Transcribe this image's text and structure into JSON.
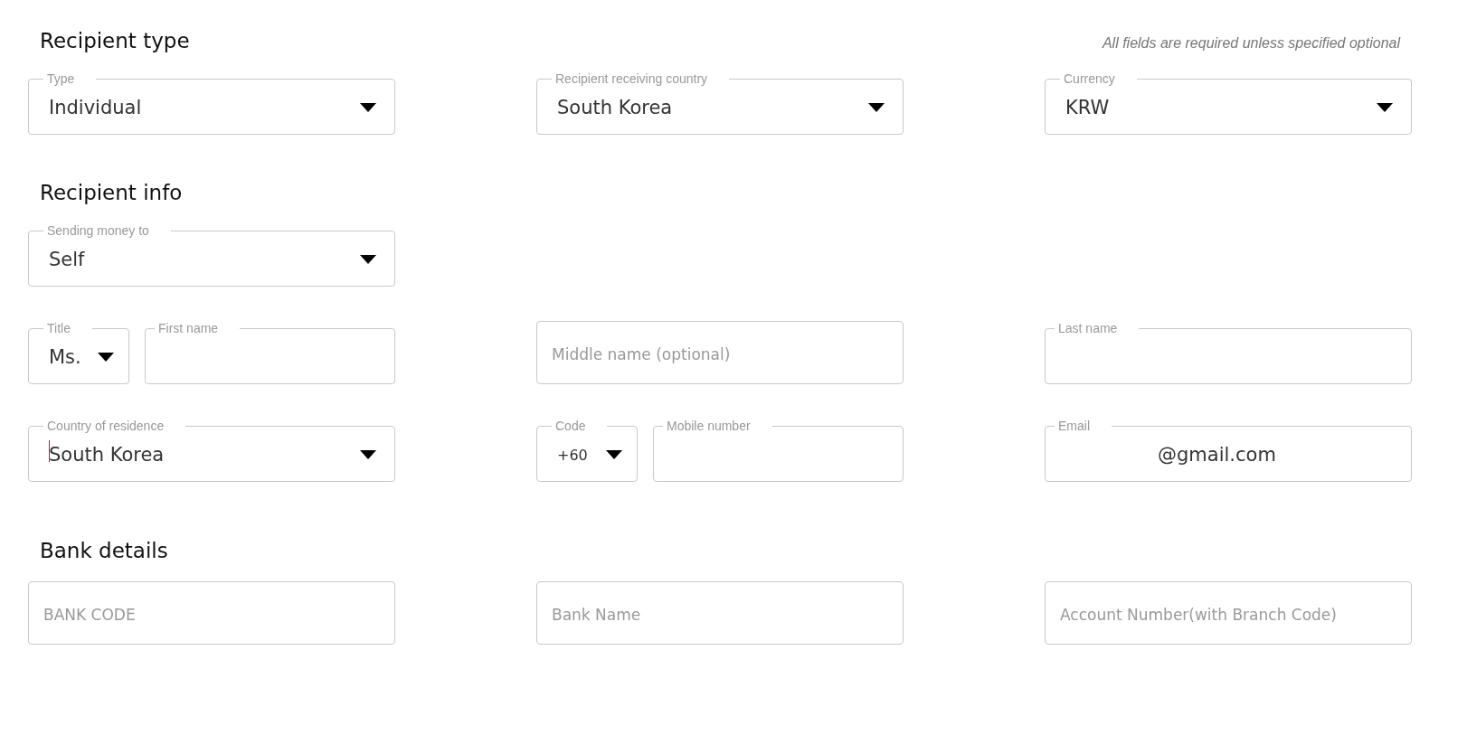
{
  "note": "All fields are required unless specified optional",
  "sections": [
    {
      "heading": "Recipient type",
      "rows": [
        [
          [
            {
              "kind": "select",
              "label": "Type",
              "value": "Individual"
            }
          ],
          [
            {
              "kind": "select",
              "label": "Recipient receiving country",
              "value": "South Korea"
            }
          ],
          [
            {
              "kind": "select",
              "label": "Currency",
              "value": "KRW"
            }
          ]
        ]
      ]
    },
    {
      "heading": "Recipient info",
      "rows": [
        [
          [
            {
              "kind": "select",
              "label": "Sending money to",
              "value": "Self"
            }
          ]
        ],
        [
          [
            {
              "kind": "select",
              "label": "Title",
              "value": "Ms."
            },
            {
              "kind": "text",
              "label": "First name"
            }
          ],
          [
            {
              "kind": "text",
              "placeholder": "Middle name (optional)"
            }
          ],
          [
            {
              "kind": "text",
              "label": "Last name"
            }
          ]
        ],
        [
          [
            {
              "kind": "select",
              "label": "Country of residence",
              "value": "South Korea",
              "cursor": true
            }
          ],
          [
            {
              "kind": "select",
              "label": "Code",
              "value": "+60"
            },
            {
              "kind": "text",
              "label": "Mobile number"
            }
          ],
          [
            {
              "kind": "text",
              "label": "Email",
              "value": "@gmail.com"
            }
          ]
        ]
      ]
    },
    {
      "heading": "Bank details",
      "rows": [
        [
          [
            {
              "kind": "text",
              "placeholder": "BANK CODE"
            }
          ],
          [
            {
              "kind": "text",
              "placeholder": "Bank Name"
            }
          ],
          [
            {
              "kind": "text",
              "placeholder": "Account Number(with Branch Code)"
            }
          ]
        ]
      ]
    }
  ]
}
